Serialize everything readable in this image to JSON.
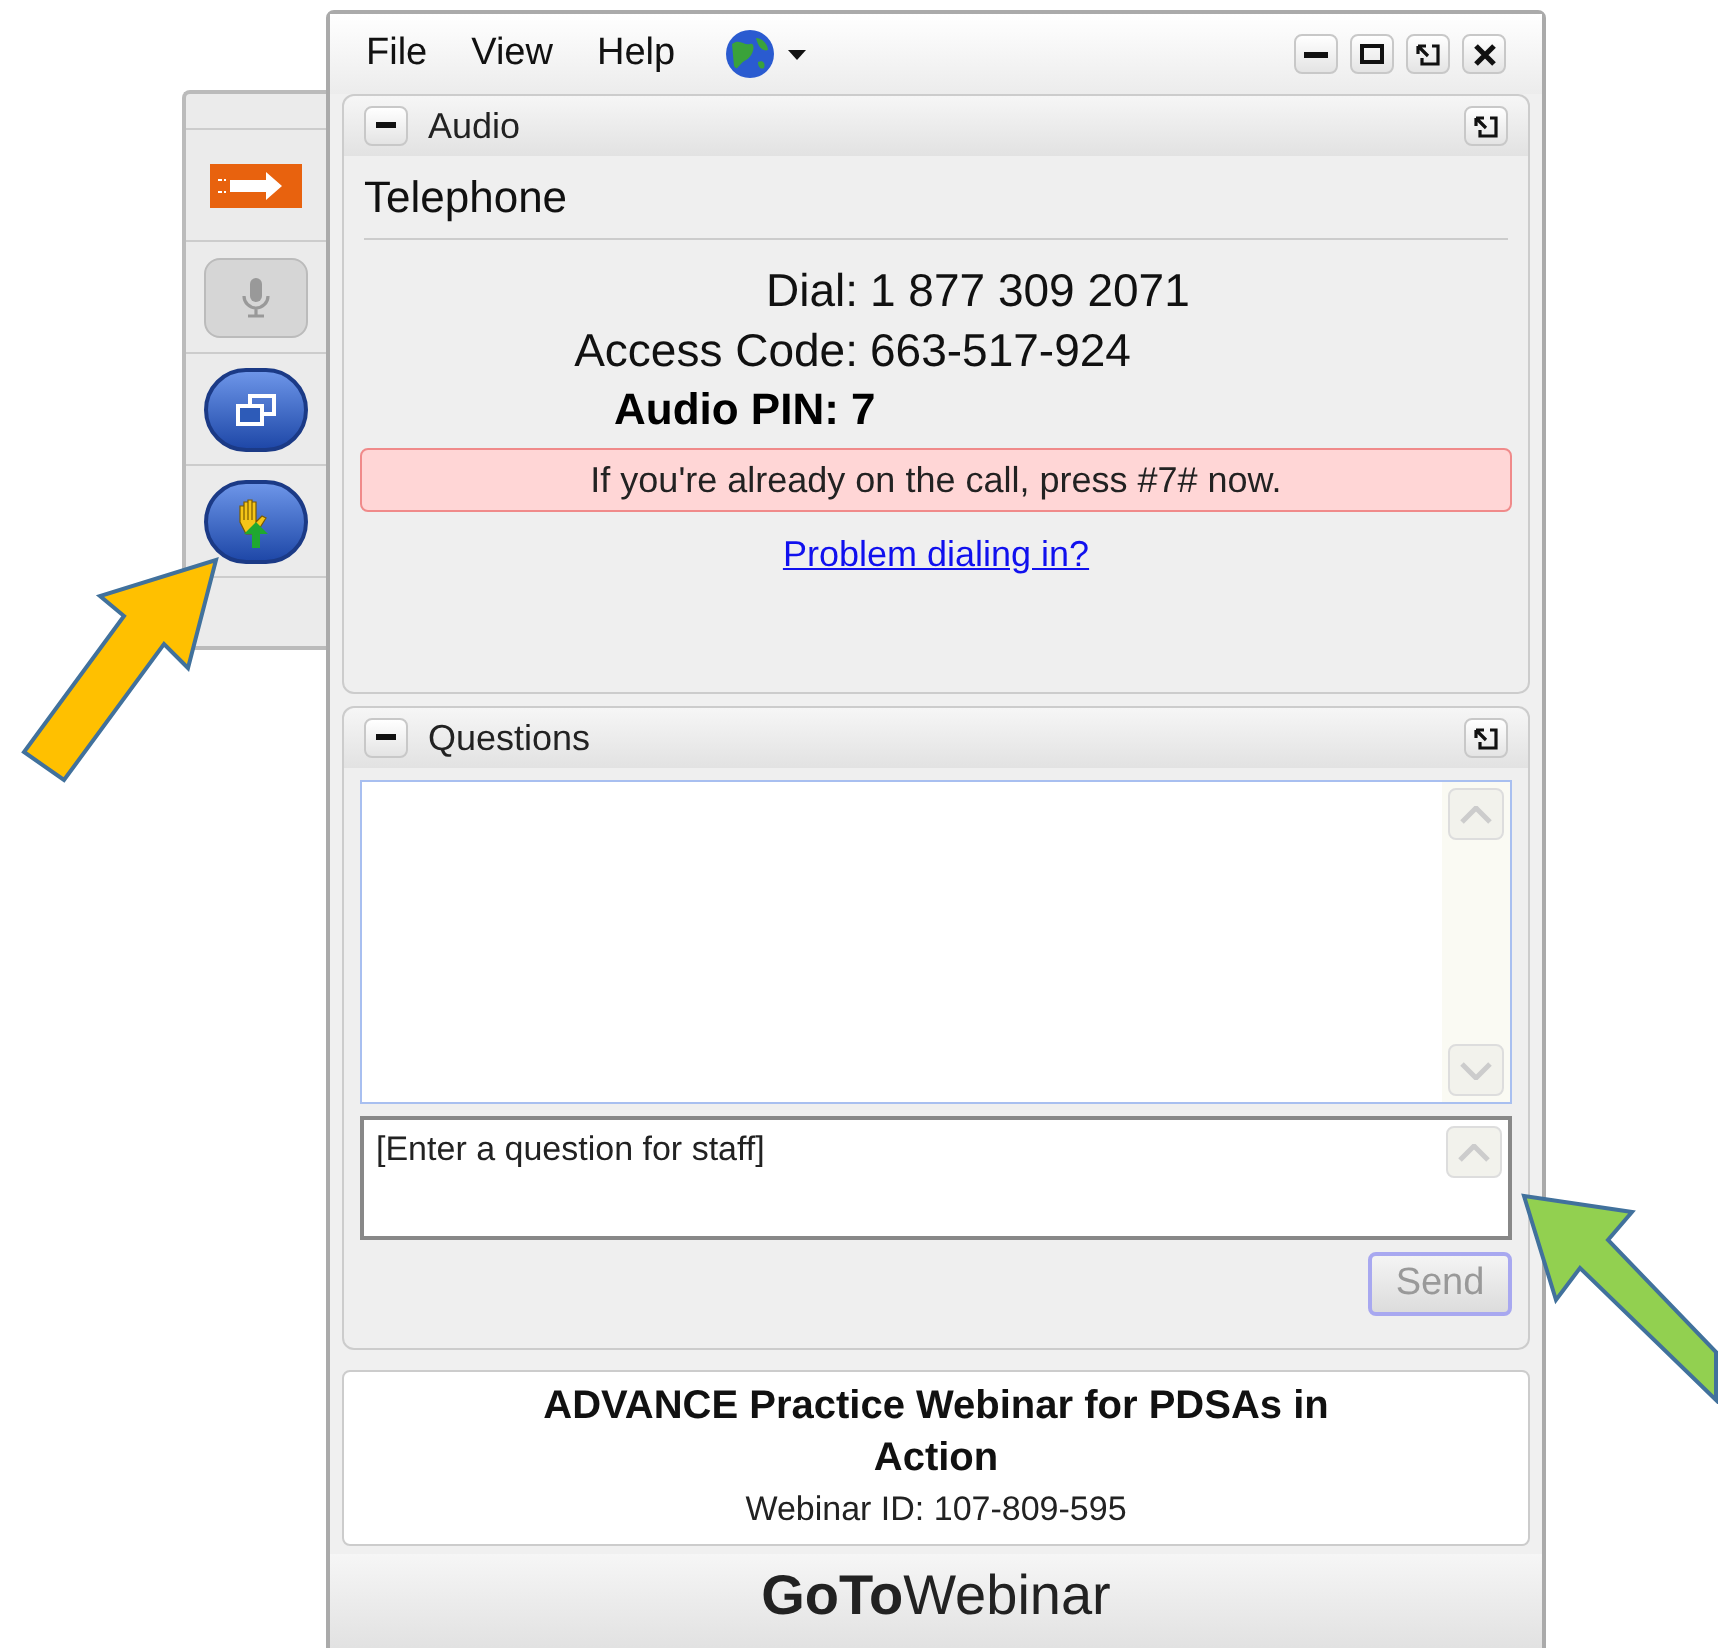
{
  "menu": [
    "File",
    "View",
    "Help"
  ],
  "toolbar": [
    {
      "kind": "arrow",
      "disabled": false
    },
    {
      "kind": "mic",
      "disabled": true
    },
    {
      "kind": "windows",
      "disabled": false
    },
    {
      "kind": "hand",
      "disabled": false
    }
  ],
  "audio": {
    "title": "Audio",
    "mode": "Telephone",
    "dial_label": "Dial:",
    "dial": "1 877 309 2071",
    "code_label": "Access Code:",
    "code": "663-517-924",
    "pin": "Audio PIN: 7",
    "notice": "If you're already on the call, press #7# now.",
    "link": "Problem dialing in?"
  },
  "questions": {
    "title": "Questions",
    "placeholder": "[Enter a question for staff]",
    "send": {
      "label": "Send",
      "disabled": true
    }
  },
  "webinar": {
    "title": "ADVANCE Practice Webinar for PDSAs in Action",
    "id": "Webinar ID: 107-809-595"
  },
  "logo": {
    "bold": "GoTo",
    "light": "Webinar"
  }
}
